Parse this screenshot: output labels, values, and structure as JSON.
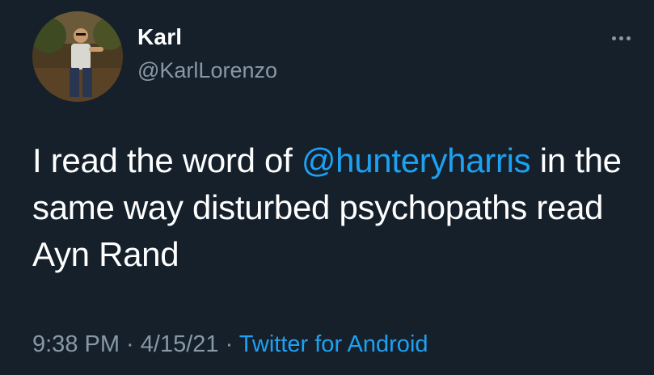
{
  "author": {
    "display_name": "Karl",
    "handle": "@KarlLorenzo"
  },
  "tweet": {
    "text_before_mention": "I read the word of ",
    "mention": "@hunteryharris",
    "text_after_mention": " in the same way disturbed psychopaths read Ayn Rand"
  },
  "meta": {
    "time": "9:38 PM",
    "separator": " · ",
    "date": "4/15/21",
    "source": "Twitter for Android"
  },
  "icons": {
    "more": "more-horizontal-icon",
    "avatar": "profile-avatar"
  },
  "colors": {
    "background": "#15202b",
    "text": "#ffffff",
    "secondary": "#8899a6",
    "accent": "#1da1f2"
  }
}
